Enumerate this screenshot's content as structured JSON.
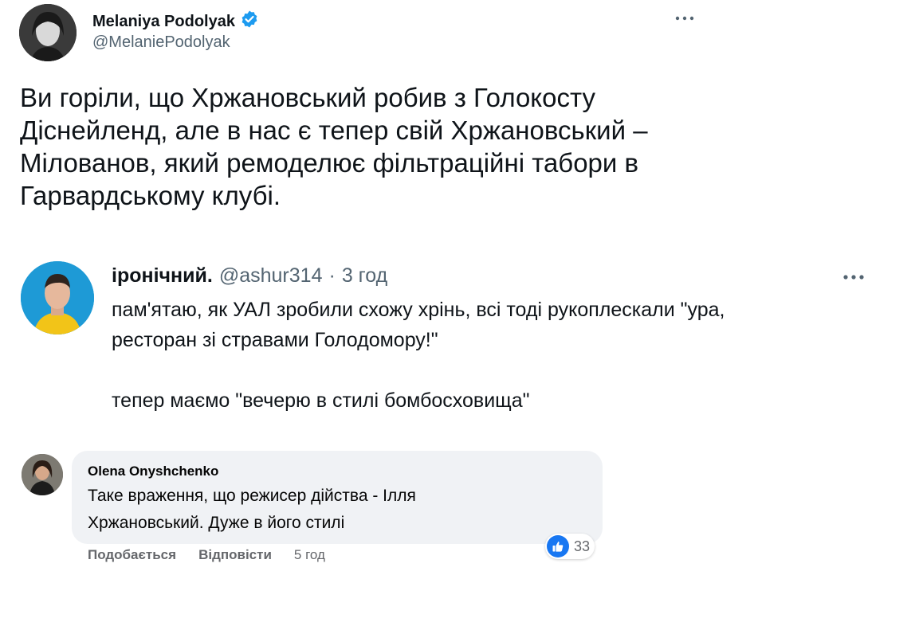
{
  "tweet": {
    "author_name": "Melaniya Podolyak",
    "author_handle": "@MelaniePodolyak",
    "text": "Ви горіли, що Хржановський робив з Голокосту\nДіснейленд, але в нас є тепер свій Хржановський –\nМілованов, який ремоделює фільтраційні табори в\nГарвардському клубі.",
    "verified_icon": "verified-badge-icon",
    "more_icon": "more-icon"
  },
  "reply": {
    "author_name": "іронічний.",
    "author_handle": "@ashur314",
    "separator": "·",
    "time": "3 год",
    "text": "пам'ятаю, як УАЛ зробили схожу хрінь, всі тоді рукоплескали \"ура,\nресторан зі стравами Голодомору!\"\n\nтепер маємо \"вечерю в стилі бомбосховища\"",
    "more_icon": "more-icon"
  },
  "comment": {
    "author_name": "Olena Onyshchenko",
    "text": "Таке враження, що режисер дійства - Ілля\nХржановський. Дуже в його стилі",
    "like_label": "Подобається",
    "reply_label": "Відповісти",
    "time": "5 год",
    "reaction_count": "33",
    "reaction_icon": "thumbs-up-icon"
  },
  "colors": {
    "verified": "#1d9bf0",
    "secondary_text": "#536471",
    "fb_bubble": "#f0f2f5",
    "fb_like": "#1877f2"
  }
}
